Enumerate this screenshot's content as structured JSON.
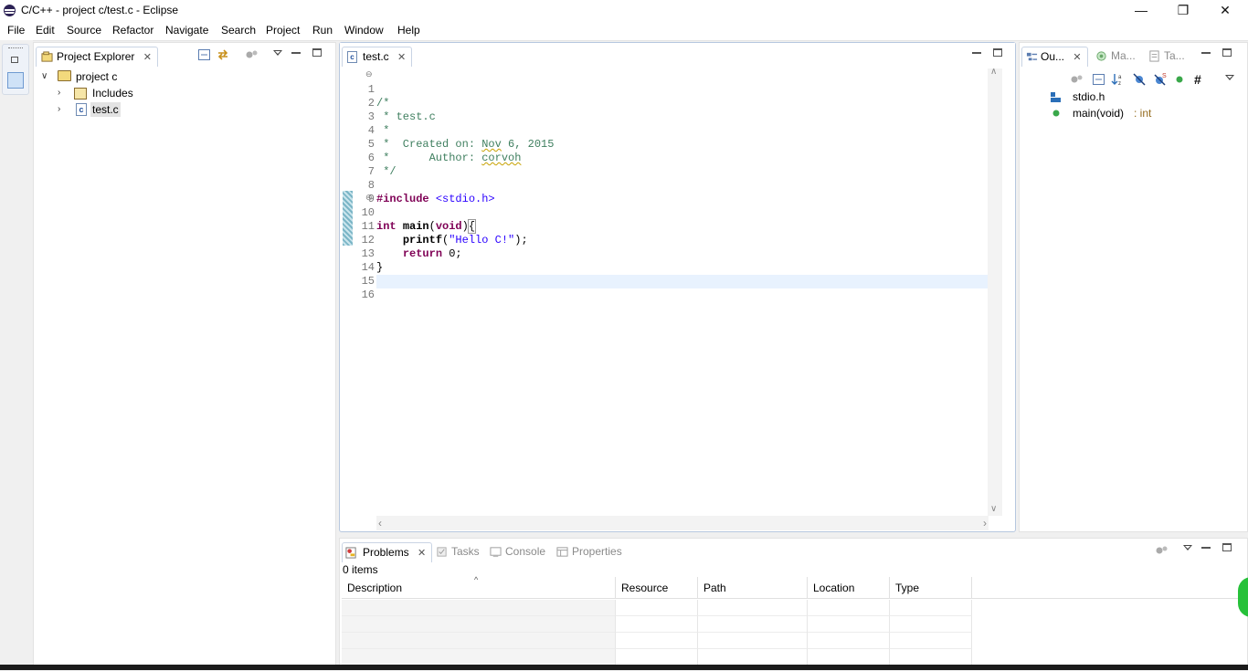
{
  "window": {
    "title": "C/C++ - project c/test.c - Eclipse",
    "minimize": "—",
    "restore": "❐",
    "close": "✕"
  },
  "menu": [
    "File",
    "Edit",
    "Source",
    "Refactor",
    "Navigate",
    "Search",
    "Project",
    "Run",
    "Window",
    "Help"
  ],
  "project_explorer": {
    "tab_label": "Project Explorer",
    "tree": {
      "project": "project c",
      "children": [
        "Includes",
        "test.c"
      ]
    }
  },
  "editor": {
    "tab_label": "test.c",
    "lines": [
      {
        "n": "1",
        "text": "/*"
      },
      {
        "n": "2",
        "text": " * test.c"
      },
      {
        "n": "3",
        "text": " *"
      },
      {
        "n": "4",
        "text": " *  Created on: Nov 6, 2015"
      },
      {
        "n": "5",
        "text": " *      Author: corvoh"
      },
      {
        "n": "6",
        "text": " */"
      },
      {
        "n": "7",
        "text": ""
      },
      {
        "n": "8",
        "text": "#include <stdio.h>"
      },
      {
        "n": "9",
        "text": ""
      },
      {
        "n": "10",
        "text": "int main(void){"
      },
      {
        "n": "11",
        "text": "    printf(\"Hello C!\");"
      },
      {
        "n": "12",
        "text": "    return 0;"
      },
      {
        "n": "13",
        "text": "}"
      },
      {
        "n": "14",
        "text": ""
      },
      {
        "n": "15",
        "text": ""
      },
      {
        "n": "16",
        "text": ""
      }
    ]
  },
  "outline": {
    "tabs": [
      "Ou...",
      "Ma...",
      "Ta..."
    ],
    "items": [
      {
        "name": "stdio.h",
        "type": ""
      },
      {
        "name": "main(void)",
        "type": " : int"
      }
    ]
  },
  "problems": {
    "tabs": [
      "Problems",
      "Tasks",
      "Console",
      "Properties"
    ],
    "count": "0 items",
    "columns": [
      "Description",
      "Resource",
      "Path",
      "Location",
      "Type"
    ]
  },
  "colors": {
    "keyword": "#7f0055",
    "comment": "#3f7f5f",
    "string": "#2a00ff",
    "current_line": "#e8f2fe"
  }
}
